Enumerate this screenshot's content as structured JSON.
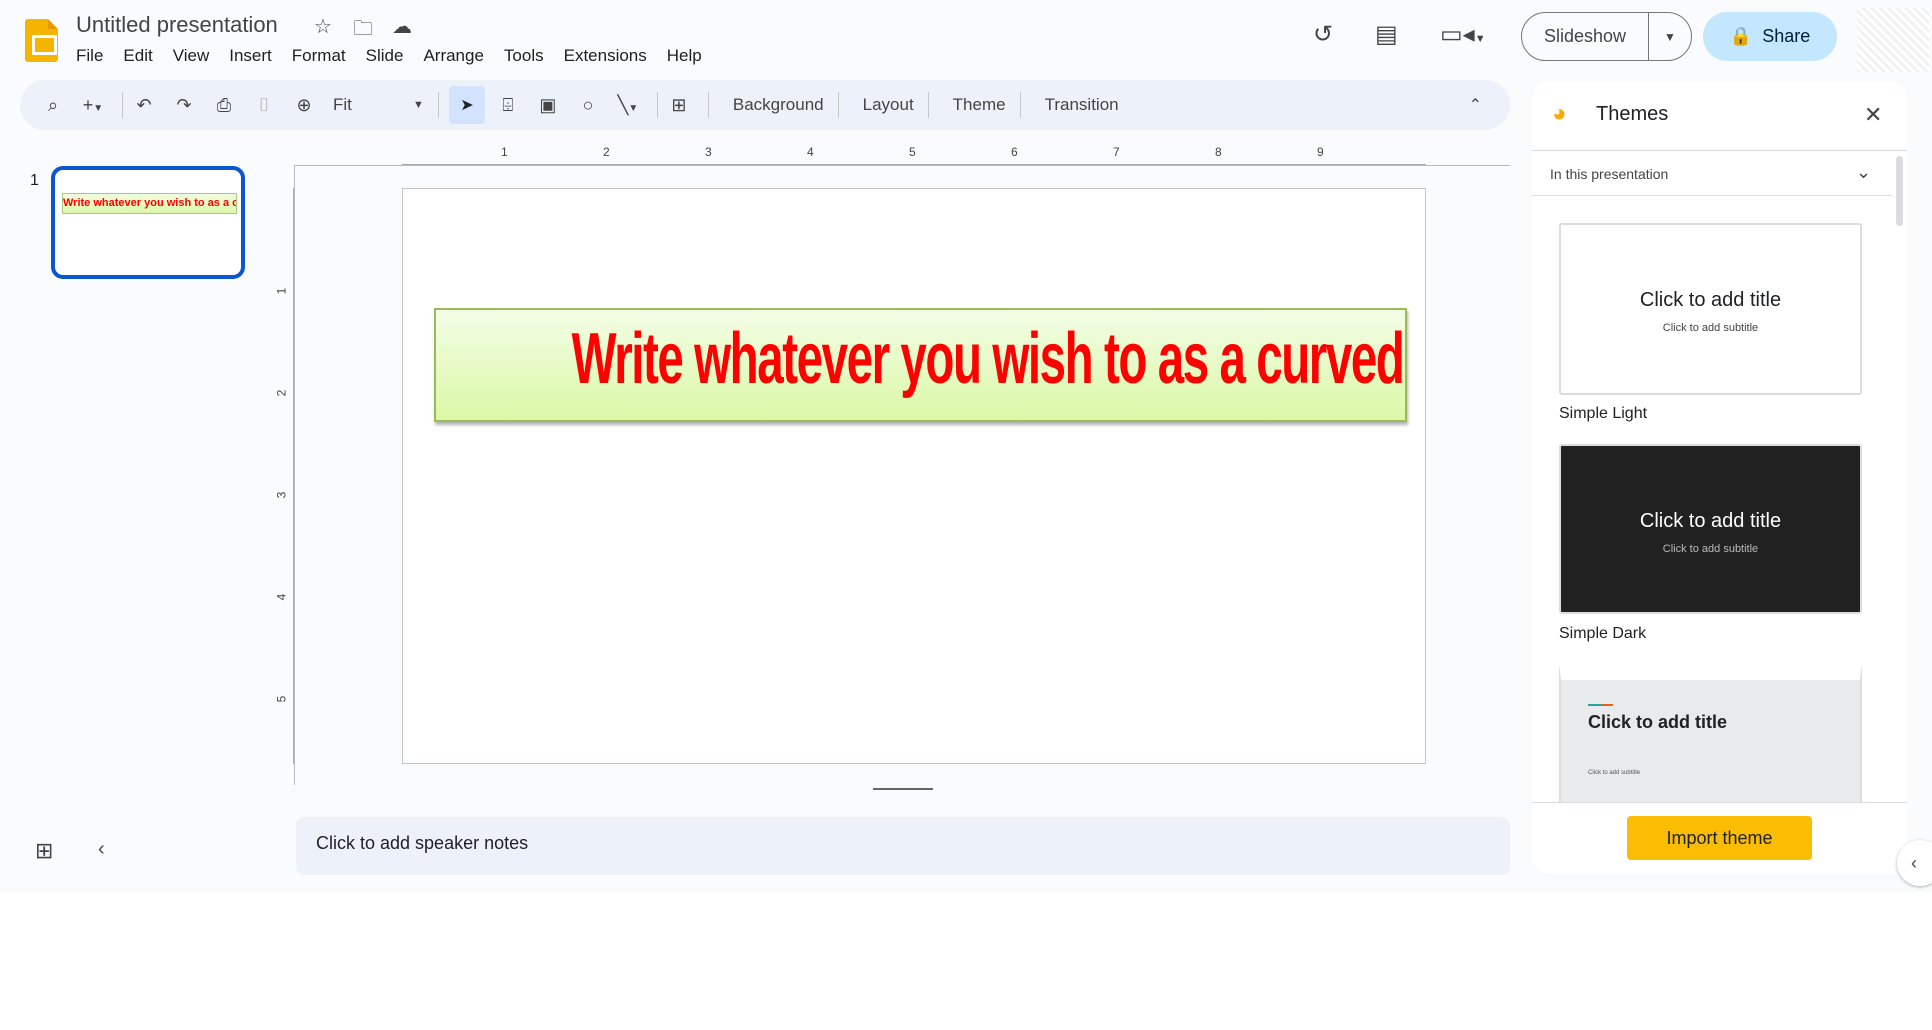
{
  "app": {
    "title": "Untitled presentation",
    "accent": "#0b57d0"
  },
  "menu": [
    "File",
    "Edit",
    "View",
    "Insert",
    "Format",
    "Slide",
    "Arrange",
    "Tools",
    "Extensions",
    "Help"
  ],
  "toolbar": {
    "zoom": "Fit",
    "background": "Background",
    "layout": "Layout",
    "theme": "Theme",
    "transition": "Transition"
  },
  "header": {
    "slideshow": "Slideshow",
    "share": "Share"
  },
  "filmstrip": {
    "number": "1"
  },
  "slide": {
    "text": "Write whatever you wish to as a curved text",
    "text_color": "#ff0000"
  },
  "ruler": {
    "h": [
      "1",
      "2",
      "3",
      "4",
      "5",
      "6",
      "7",
      "8",
      "9"
    ],
    "v": [
      "1",
      "2",
      "3",
      "4",
      "5"
    ]
  },
  "notes": {
    "placeholder": "Click to add speaker notes"
  },
  "themes": {
    "title": "Themes",
    "filter": "In this presentation",
    "items": [
      {
        "name": "Simple Light",
        "title": "Click to add title",
        "subtitle": "Click to add subtitle"
      },
      {
        "name": "Simple Dark",
        "title": "Click to add title",
        "subtitle": "Click to add subtitle"
      },
      {
        "name": "",
        "title": "Click to add title",
        "subtitle": "Click to add subtitle"
      }
    ],
    "import": "Import theme"
  }
}
